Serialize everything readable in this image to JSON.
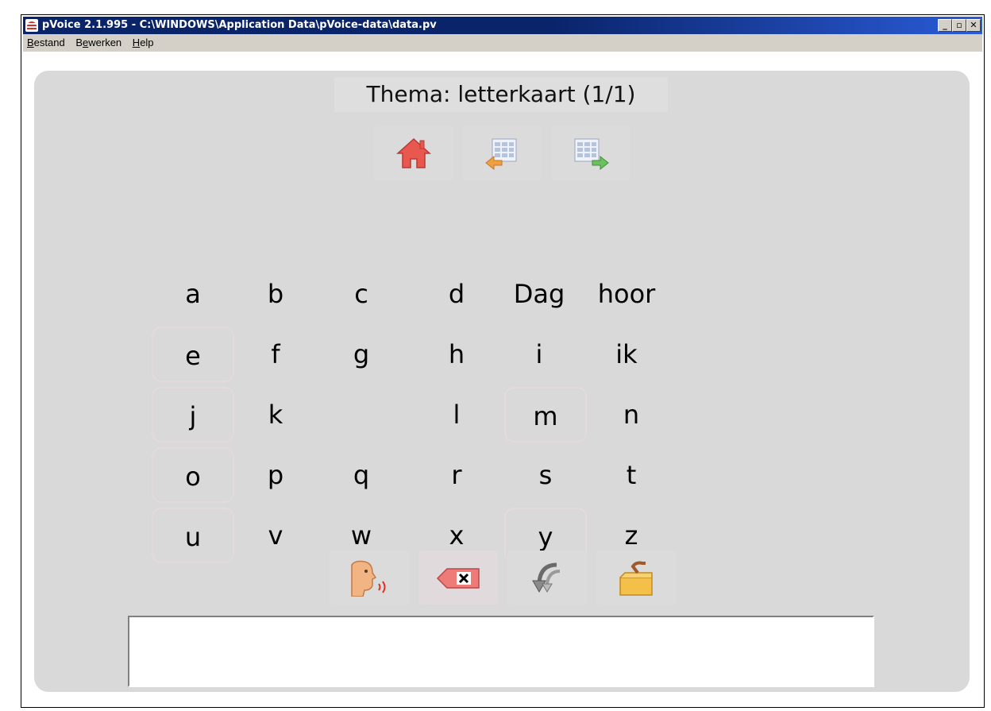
{
  "window": {
    "title": "pVoice 2.1.995 - C:\\WINDOWS\\Application Data\\pVoice-data\\data.pv",
    "controls": {
      "minimize": "_",
      "restore": "▫",
      "close": "✕"
    }
  },
  "menu": [
    {
      "label": "Bestand",
      "accel": "B",
      "rest": "estand"
    },
    {
      "label": "Bewerken",
      "pre": "B",
      "accel": "e",
      "rest": "werken"
    },
    {
      "label": "Help",
      "accel": "H",
      "rest": "elp"
    }
  ],
  "thema": "Thema: letterkaart (1/1)",
  "nav": {
    "icons": [
      "home-icon",
      "previous-page-icon",
      "next-page-icon"
    ]
  },
  "keys": {
    "r0": [
      "a",
      "b",
      "c",
      "d",
      "Dag",
      "hoor"
    ],
    "r1": [
      "e",
      "f",
      "g",
      "h",
      "i",
      "ik"
    ],
    "r2": [
      "j",
      "k",
      "",
      "l",
      "m",
      "n"
    ],
    "r3": [
      "o",
      "p",
      "q",
      "r",
      "s",
      "t"
    ],
    "r4": [
      "u",
      "v",
      "w",
      "x",
      "y",
      "z"
    ]
  },
  "actions": {
    "icons": [
      "speak-icon",
      "backspace-icon",
      "undo-icon",
      "open-folder-icon"
    ]
  },
  "output": {
    "text": ""
  },
  "colors": {
    "titlebar": "#0a246a",
    "panel": "#d9d9d9",
    "key_frame": "#e4d9dd",
    "home_icon": "#e8584e"
  }
}
